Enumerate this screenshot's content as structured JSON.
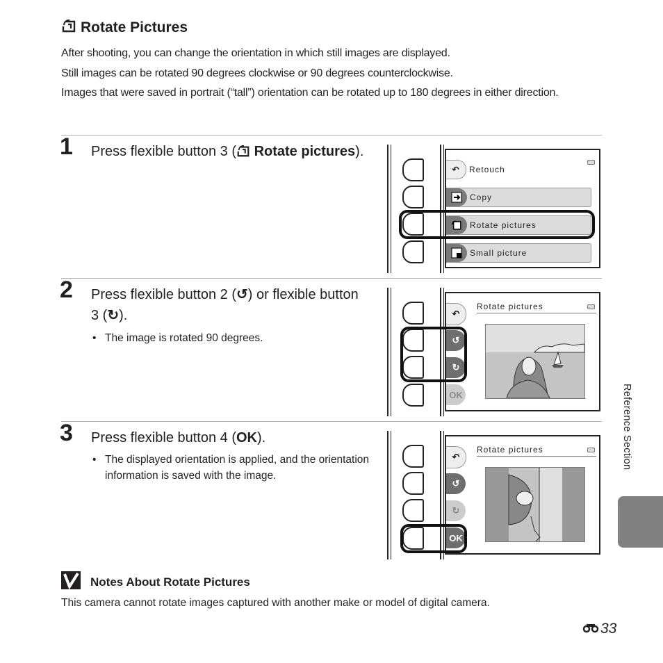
{
  "heading": {
    "icon": "rotate-pictures-icon",
    "title": "Rotate Pictures"
  },
  "intro": [
    "After shooting, you can change the orientation in which still images are displayed.",
    "Still images can be rotated 90 degrees clockwise or 90 degrees counterclockwise.",
    "Images that were saved in portrait (“tall”) orientation can be rotated up to 180 degrees in either direction."
  ],
  "steps": [
    {
      "number": "1",
      "text_pre": "Press flexible button 3 (",
      "text_bold": "Rotate pictures",
      "text_post": ").",
      "bullets": [],
      "screen": {
        "back_label": "Retouch",
        "menu": [
          "Copy",
          "Rotate pictures",
          "Small picture"
        ],
        "highlighted": "Rotate pictures"
      }
    },
    {
      "number": "2",
      "text_a": "Press flexible button 2 (",
      "text_b": ") or flexible button 3 (",
      "text_c": ").",
      "bullets": [
        "The image is rotated 90 degrees."
      ],
      "screen": {
        "title": "Rotate pictures",
        "buttons": [
          "back",
          "rotate-ccw",
          "rotate-cw",
          "OK"
        ]
      }
    },
    {
      "number": "3",
      "text_pre": "Press flexible button 4 (",
      "text_bold": "OK",
      "text_post": ").",
      "bullets": [
        "The displayed orientation is applied, and the orientation information is saved with the image."
      ],
      "screen": {
        "title": "Rotate pictures",
        "buttons": [
          "back",
          "rotate-ccw",
          "rotate-cw",
          "OK"
        ]
      }
    }
  ],
  "note": {
    "title": "Notes About Rotate Pictures",
    "body": "This camera cannot rotate images captured with another make or model of digital camera."
  },
  "sidebar": {
    "label": "Reference Section"
  },
  "footer": {
    "page_prefix_icon": "binoculars-icon",
    "page_number": "33"
  },
  "colors": {
    "text": "#231f20",
    "tab": "#808080",
    "rule": "#b3b3b3"
  }
}
